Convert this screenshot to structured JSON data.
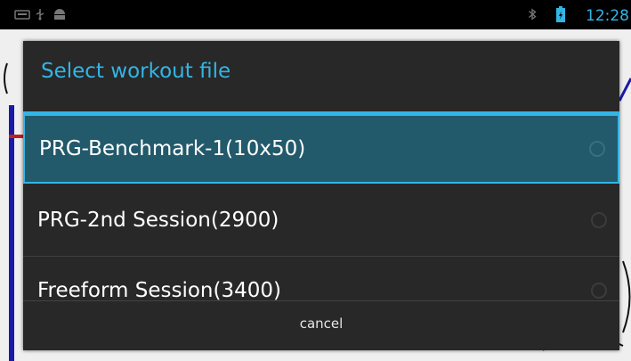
{
  "status_bar": {
    "time": "12:28",
    "icons": [
      "keyboard-icon",
      "usb-icon",
      "android-debug-icon",
      "bluetooth-icon",
      "battery-icon"
    ],
    "accent_color": "#33b5e5"
  },
  "dialog": {
    "title": "Select workout file",
    "items": [
      {
        "label": "PRG-Benchmark-1(10x50)",
        "selected": true
      },
      {
        "label": "PRG-2nd Session(2900)",
        "selected": false
      },
      {
        "label": "Freeform Session(3400)",
        "selected": false
      }
    ],
    "cancel_label": "cancel"
  }
}
